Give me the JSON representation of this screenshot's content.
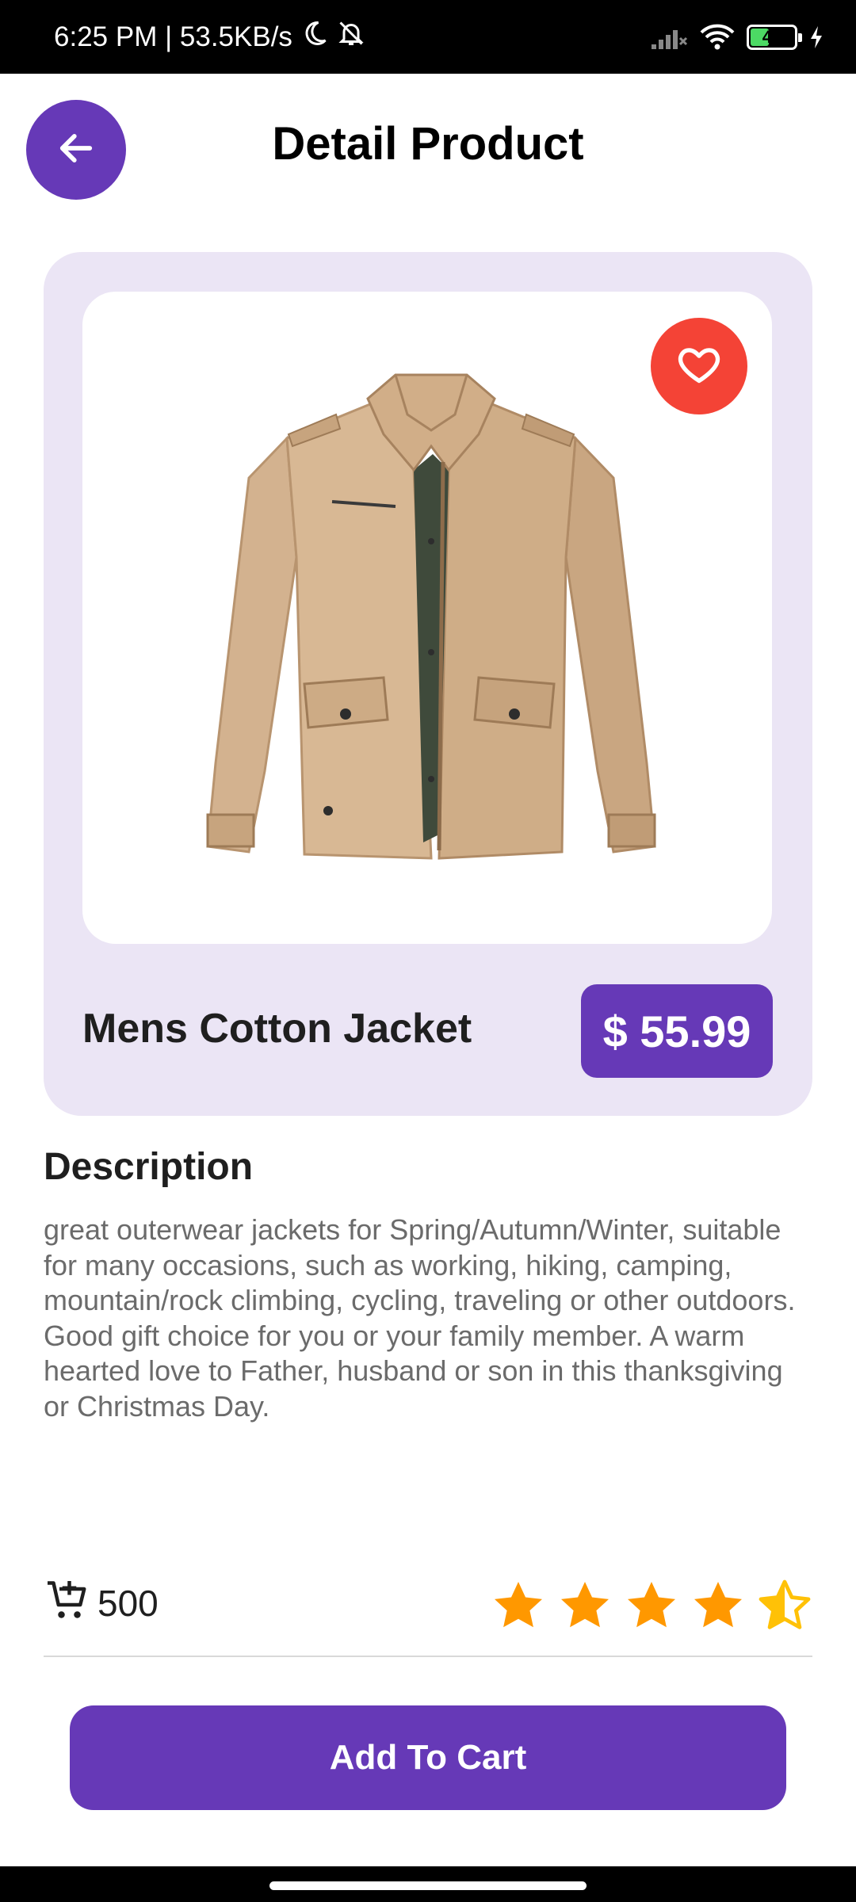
{
  "status_bar": {
    "time_and_speed": "6:25 PM | 53.5KB/s",
    "battery_level": "40",
    "icons": [
      "moon-icon",
      "bell-off-icon",
      "signal-icon",
      "wifi-icon",
      "battery-icon",
      "charging-icon"
    ]
  },
  "header": {
    "title": "Detail Product",
    "back_icon": "arrow-left-icon"
  },
  "product": {
    "name": "Mens Cotton Jacket",
    "price": "$ 55.99",
    "favorite_icon": "heart-icon",
    "image": "khaki-cotton-jacket"
  },
  "description": {
    "heading": "Description",
    "text": "great outerwear jackets for Spring/Autumn/Winter, suitable for many occasions, such as working, hiking, camping, mountain/rock climbing, cycling, traveling or other outdoors. Good gift choice for you or your family member. A warm hearted love to Father, husband or son in this thanksgiving or Christmas Day."
  },
  "stock": {
    "icon": "cart-add-icon",
    "count": "500"
  },
  "rating": {
    "value": 4.5,
    "max": 5
  },
  "actions": {
    "add_to_cart_label": "Add To Cart"
  },
  "colors": {
    "primary": "#6639b7",
    "favorite": "#f44336",
    "card_background": "#ebe5f5",
    "star": "#ff9800"
  }
}
